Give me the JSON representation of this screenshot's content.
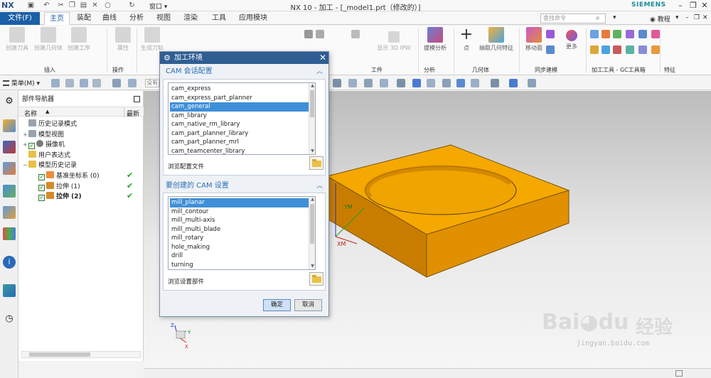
{
  "app": {
    "logo": "NX",
    "window_title": "NX 10 - 加工 - [_model1.prt（修改的）]",
    "brand": "SIEMENS",
    "window_menu": "窗口"
  },
  "tabs": {
    "file": "文件(F)",
    "items": [
      "主页",
      "装配",
      "曲线",
      "分析",
      "视图",
      "渲染",
      "工具",
      "应用模块"
    ],
    "active": "主页",
    "search_placeholder": "查找命令",
    "help_label": "教程"
  },
  "ribbon": {
    "buttons": [
      {
        "label": "创建刀具",
        "dim": true
      },
      {
        "label": "创建几何体",
        "dim": true
      },
      {
        "label": "创建工序",
        "dim": true
      },
      {
        "label": "属性",
        "dim": true
      },
      {
        "label": "生成刀轨",
        "dim": true
      },
      {
        "label": "显示 3D IPW",
        "dim": true
      },
      {
        "label": "拔模分析",
        "dim": false
      },
      {
        "label": "点",
        "dim": false
      },
      {
        "label": "抽取几何特征",
        "dim": false
      },
      {
        "label": "移动面",
        "dim": false
      },
      {
        "label": "更多",
        "dim": false
      }
    ],
    "groups": [
      "插入",
      "操作",
      "工件",
      "分析",
      "几何体",
      "同步建模",
      "加工工具 - GC工具箱",
      "特征"
    ]
  },
  "toolbar2": {
    "menu_label": "菜单(M)",
    "filter_placeholder": "没有"
  },
  "navigator": {
    "title": "部件导航器",
    "col_name": "名称",
    "col_latest": "最新",
    "rows": [
      {
        "label": "历史记录模式",
        "indent": 0,
        "toggle": "",
        "checked": false,
        "icon": "gray",
        "latest": false,
        "bold": false
      },
      {
        "label": "模型视图",
        "indent": 0,
        "toggle": "+",
        "checked": false,
        "icon": "gray",
        "latest": false,
        "bold": false
      },
      {
        "label": "摄像机",
        "indent": 0,
        "toggle": "+",
        "checked": true,
        "icon": "cam",
        "latest": false,
        "bold": false
      },
      {
        "label": "用户表达式",
        "indent": 0,
        "toggle": "",
        "checked": false,
        "icon": "fold",
        "latest": false,
        "bold": false
      },
      {
        "label": "模型历史记录",
        "indent": 0,
        "toggle": "−",
        "checked": false,
        "icon": "fold",
        "latest": false,
        "bold": false
      },
      {
        "label": "基准坐标系 (0)",
        "indent": 1,
        "toggle": "",
        "checked": true,
        "icon": "csys",
        "latest": true,
        "bold": false
      },
      {
        "label": "拉伸 (1)",
        "indent": 1,
        "toggle": "",
        "checked": true,
        "icon": "ext",
        "latest": true,
        "bold": false
      },
      {
        "label": "拉伸 (2)",
        "indent": 1,
        "toggle": "",
        "checked": true,
        "icon": "ext",
        "latest": true,
        "bold": true
      }
    ]
  },
  "dialog": {
    "title": "加工环境",
    "session_header": "CAM 会话配置",
    "session_items": [
      "cam_express",
      "cam_express_part_planner",
      "cam_general",
      "cam_library",
      "cam_native_rm_library",
      "cam_part_planner_library",
      "cam_part_planner_mrl",
      "cam_teamcenter_library"
    ],
    "session_selected": "cam_general",
    "browse_config": "浏览配置文件",
    "setup_header": "要创建的 CAM 设置",
    "setup_items": [
      "mill_planar",
      "mill_contour",
      "mill_multi-axis",
      "mill_multi_blade",
      "mill_rotary",
      "hole_making",
      "drill",
      "turning"
    ],
    "setup_selected": "mill_planar",
    "browse_setup": "浏览设置部件",
    "ok": "确定",
    "cancel": "取消"
  },
  "viewport": {
    "axis_ym": "YM",
    "axis_xm": "XM",
    "axis_x": "X",
    "axis_y": "Y",
    "axis_z": "Z",
    "part_color": "#f5a800",
    "part_side_color": "#c97d00",
    "part_front_color": "#e09000"
  },
  "watermark": {
    "brand": "Bai",
    "brand_suffix": "du",
    "brand_cn": "经验",
    "url": "jingyan.baidu.com"
  }
}
